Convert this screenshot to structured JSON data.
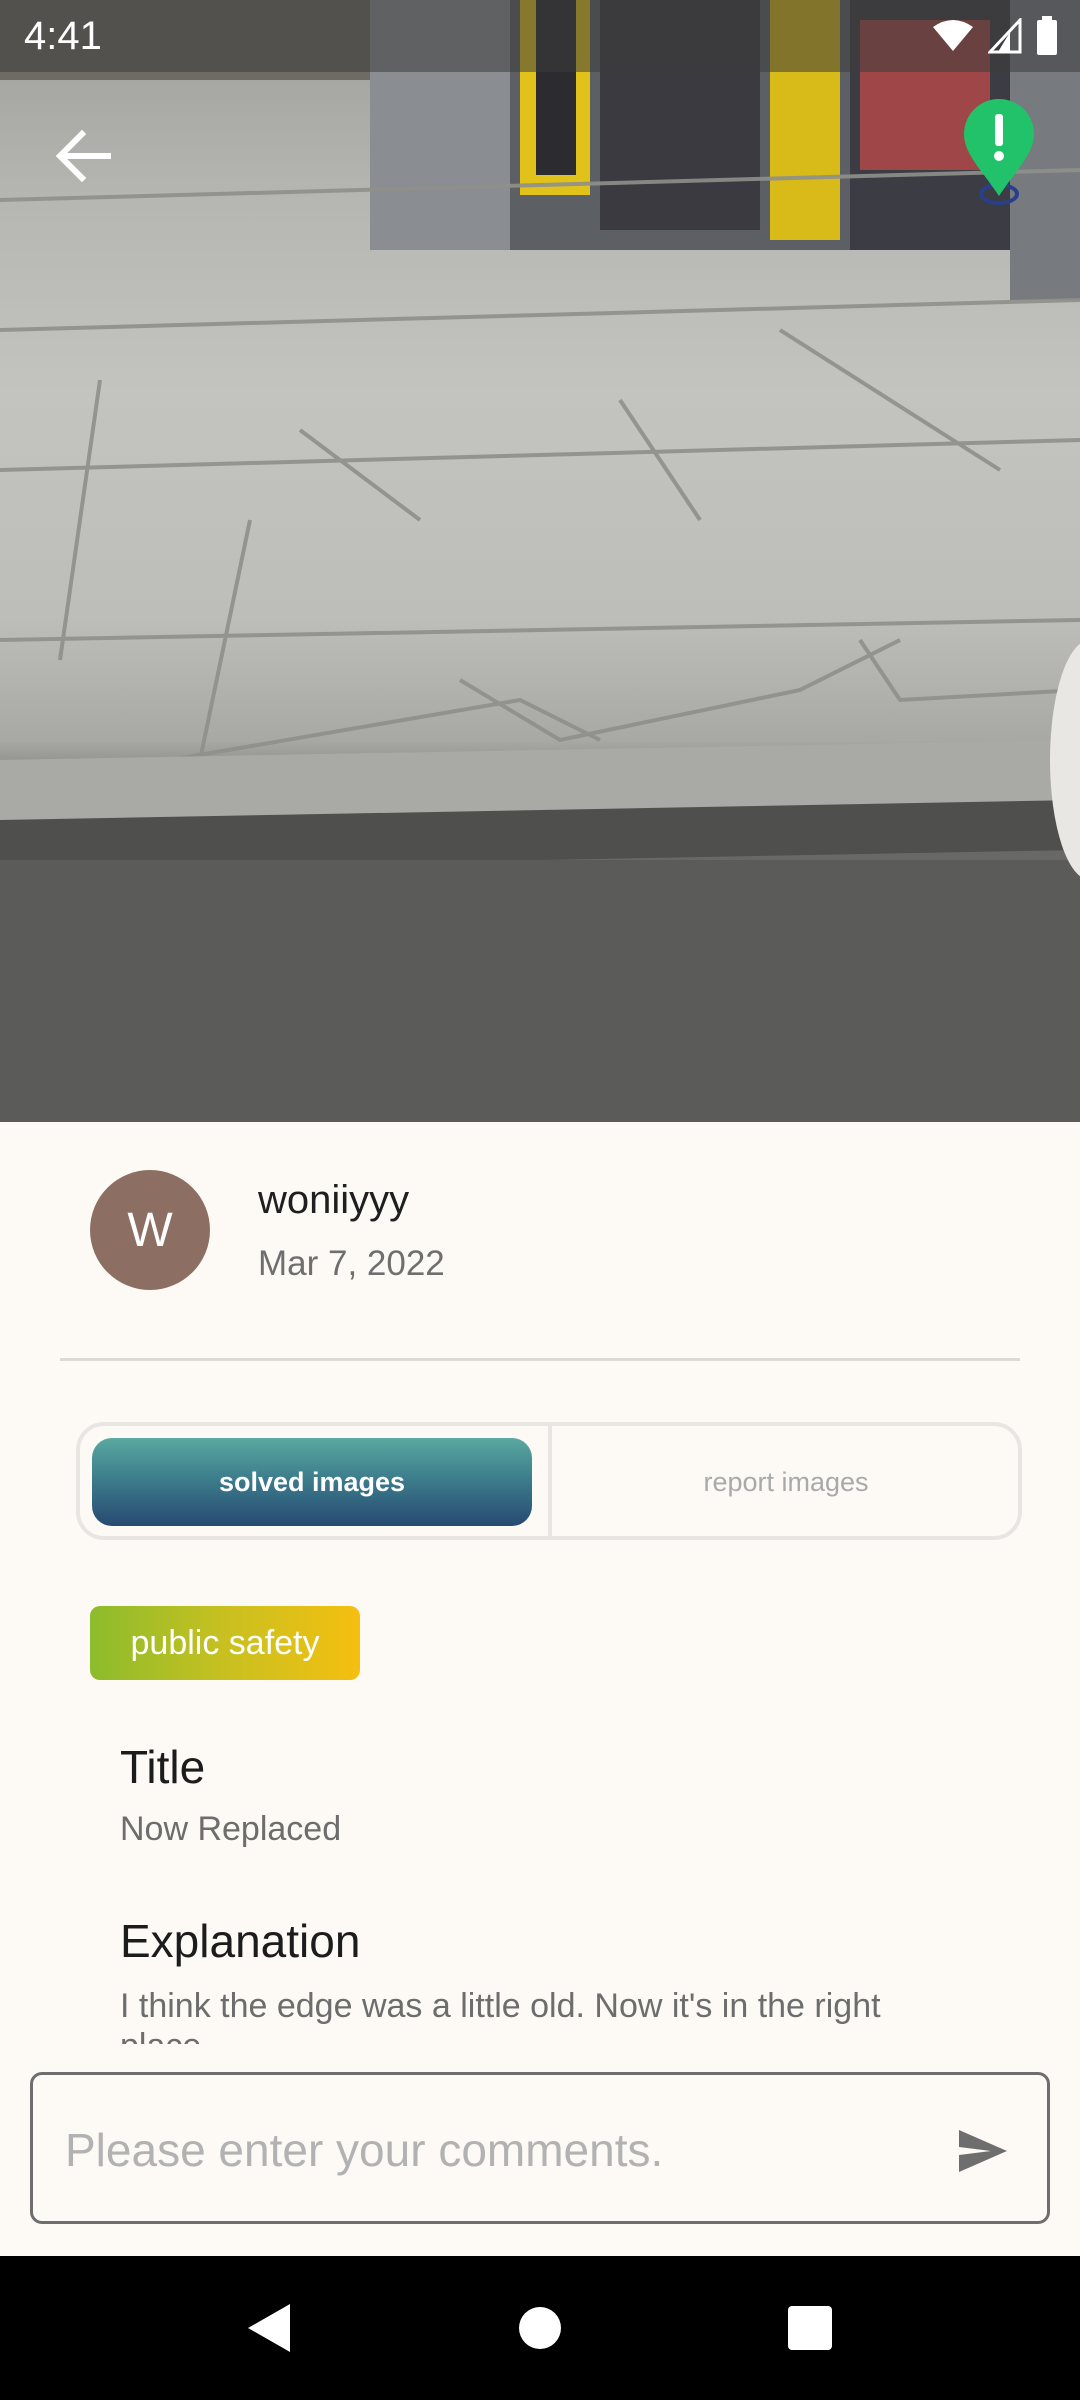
{
  "status_bar": {
    "time": "4:41"
  },
  "post": {
    "author_initial": "W",
    "author_name": "woniiyyy",
    "date": "Mar 7, 2022",
    "category": "public safety",
    "title_label": "Title",
    "title": "Now Replaced",
    "explanation_label": "Explanation",
    "explanation": "I think the edge was a little old. Now it's in the right place."
  },
  "tabs": {
    "solved_label": "solved images",
    "report_label": "report images",
    "selected": "solved images"
  },
  "comment": {
    "placeholder": "Please enter your comments.",
    "value": ""
  },
  "colors": {
    "pin": "#22c26b",
    "avatar": "#8d6e63",
    "tab_active_top": "#5aa9a0",
    "tab_active_bottom": "#274a72",
    "category_start": "#8cbc2c",
    "category_end": "#f5bf10"
  },
  "icons": {
    "back": "arrow-back-icon",
    "pin": "map-pin-alert-icon",
    "send": "send-icon",
    "wifi": "wifi-icon",
    "signal": "signal-icon",
    "battery": "battery-icon"
  }
}
